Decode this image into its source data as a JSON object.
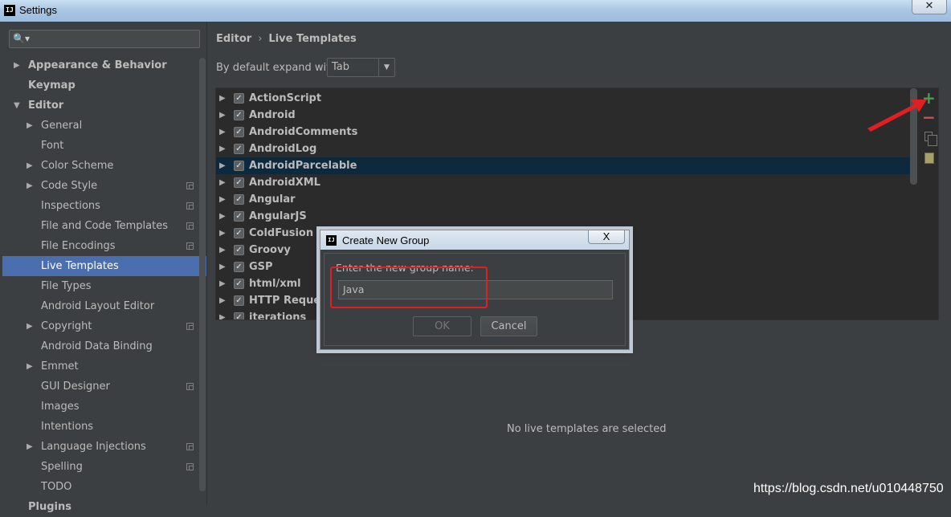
{
  "window": {
    "title": "Settings",
    "app_icon": "IJ"
  },
  "sidebar": {
    "search_placeholder": "",
    "items": [
      {
        "label": "Appearance & Behavior",
        "level": 0,
        "arrow": "right",
        "bold": true
      },
      {
        "label": "Keymap",
        "level": 0,
        "bold": true
      },
      {
        "label": "Editor",
        "level": 0,
        "arrow": "down",
        "bold": true
      },
      {
        "label": "General",
        "level": 1,
        "arrow": "right"
      },
      {
        "label": "Font",
        "level": 1
      },
      {
        "label": "Color Scheme",
        "level": 1,
        "arrow": "right"
      },
      {
        "label": "Code Style",
        "level": 1,
        "arrow": "right",
        "badge": true
      },
      {
        "label": "Inspections",
        "level": 1,
        "badge": true
      },
      {
        "label": "File and Code Templates",
        "level": 1,
        "badge": true
      },
      {
        "label": "File Encodings",
        "level": 1,
        "badge": true
      },
      {
        "label": "Live Templates",
        "level": 1,
        "selected": true
      },
      {
        "label": "File Types",
        "level": 1
      },
      {
        "label": "Android Layout Editor",
        "level": 1
      },
      {
        "label": "Copyright",
        "level": 1,
        "arrow": "right",
        "badge": true
      },
      {
        "label": "Android Data Binding",
        "level": 1
      },
      {
        "label": "Emmet",
        "level": 1,
        "arrow": "right"
      },
      {
        "label": "GUI Designer",
        "level": 1,
        "badge": true
      },
      {
        "label": "Images",
        "level": 1
      },
      {
        "label": "Intentions",
        "level": 1
      },
      {
        "label": "Language Injections",
        "level": 1,
        "arrow": "right",
        "badge": true
      },
      {
        "label": "Spelling",
        "level": 1,
        "badge": true
      },
      {
        "label": "TODO",
        "level": 1
      },
      {
        "label": "Plugins",
        "level": 0,
        "bold": true
      }
    ]
  },
  "main": {
    "breadcrumb": {
      "parent": "Editor",
      "separator": "›",
      "current": "Live Templates"
    },
    "expand_label": "By default expand with",
    "expand_value": "Tab",
    "template_groups": [
      {
        "name": "ActionScript",
        "checked": true
      },
      {
        "name": "Android",
        "checked": true
      },
      {
        "name": "AndroidComments",
        "checked": true
      },
      {
        "name": "AndroidLog",
        "checked": true
      },
      {
        "name": "AndroidParcelable",
        "checked": true,
        "selected": true
      },
      {
        "name": "AndroidXML",
        "checked": true
      },
      {
        "name": "Angular",
        "checked": true
      },
      {
        "name": "AngularJS",
        "checked": true
      },
      {
        "name": "ColdFusion",
        "checked": true
      },
      {
        "name": "Groovy",
        "checked": true
      },
      {
        "name": "GSP",
        "checked": true
      },
      {
        "name": "html/xml",
        "checked": true
      },
      {
        "name": "HTTP Request",
        "checked": true
      },
      {
        "name": "iterations",
        "checked": true
      }
    ],
    "empty_message": "No live templates are selected"
  },
  "dialog": {
    "title": "Create New Group",
    "label": "Enter the new group name:",
    "input_value": "Java",
    "ok_label": "OK",
    "cancel_label": "Cancel",
    "close_label": "X"
  },
  "watermark": "https://blog.csdn.net/u010448750",
  "colors": {
    "background": "#3c3f41",
    "selection": "#4b6eaf",
    "list_selection": "#0d293e",
    "add_green": "#499c54",
    "remove_red": "#c75450",
    "annotation_red": "#e02020"
  }
}
